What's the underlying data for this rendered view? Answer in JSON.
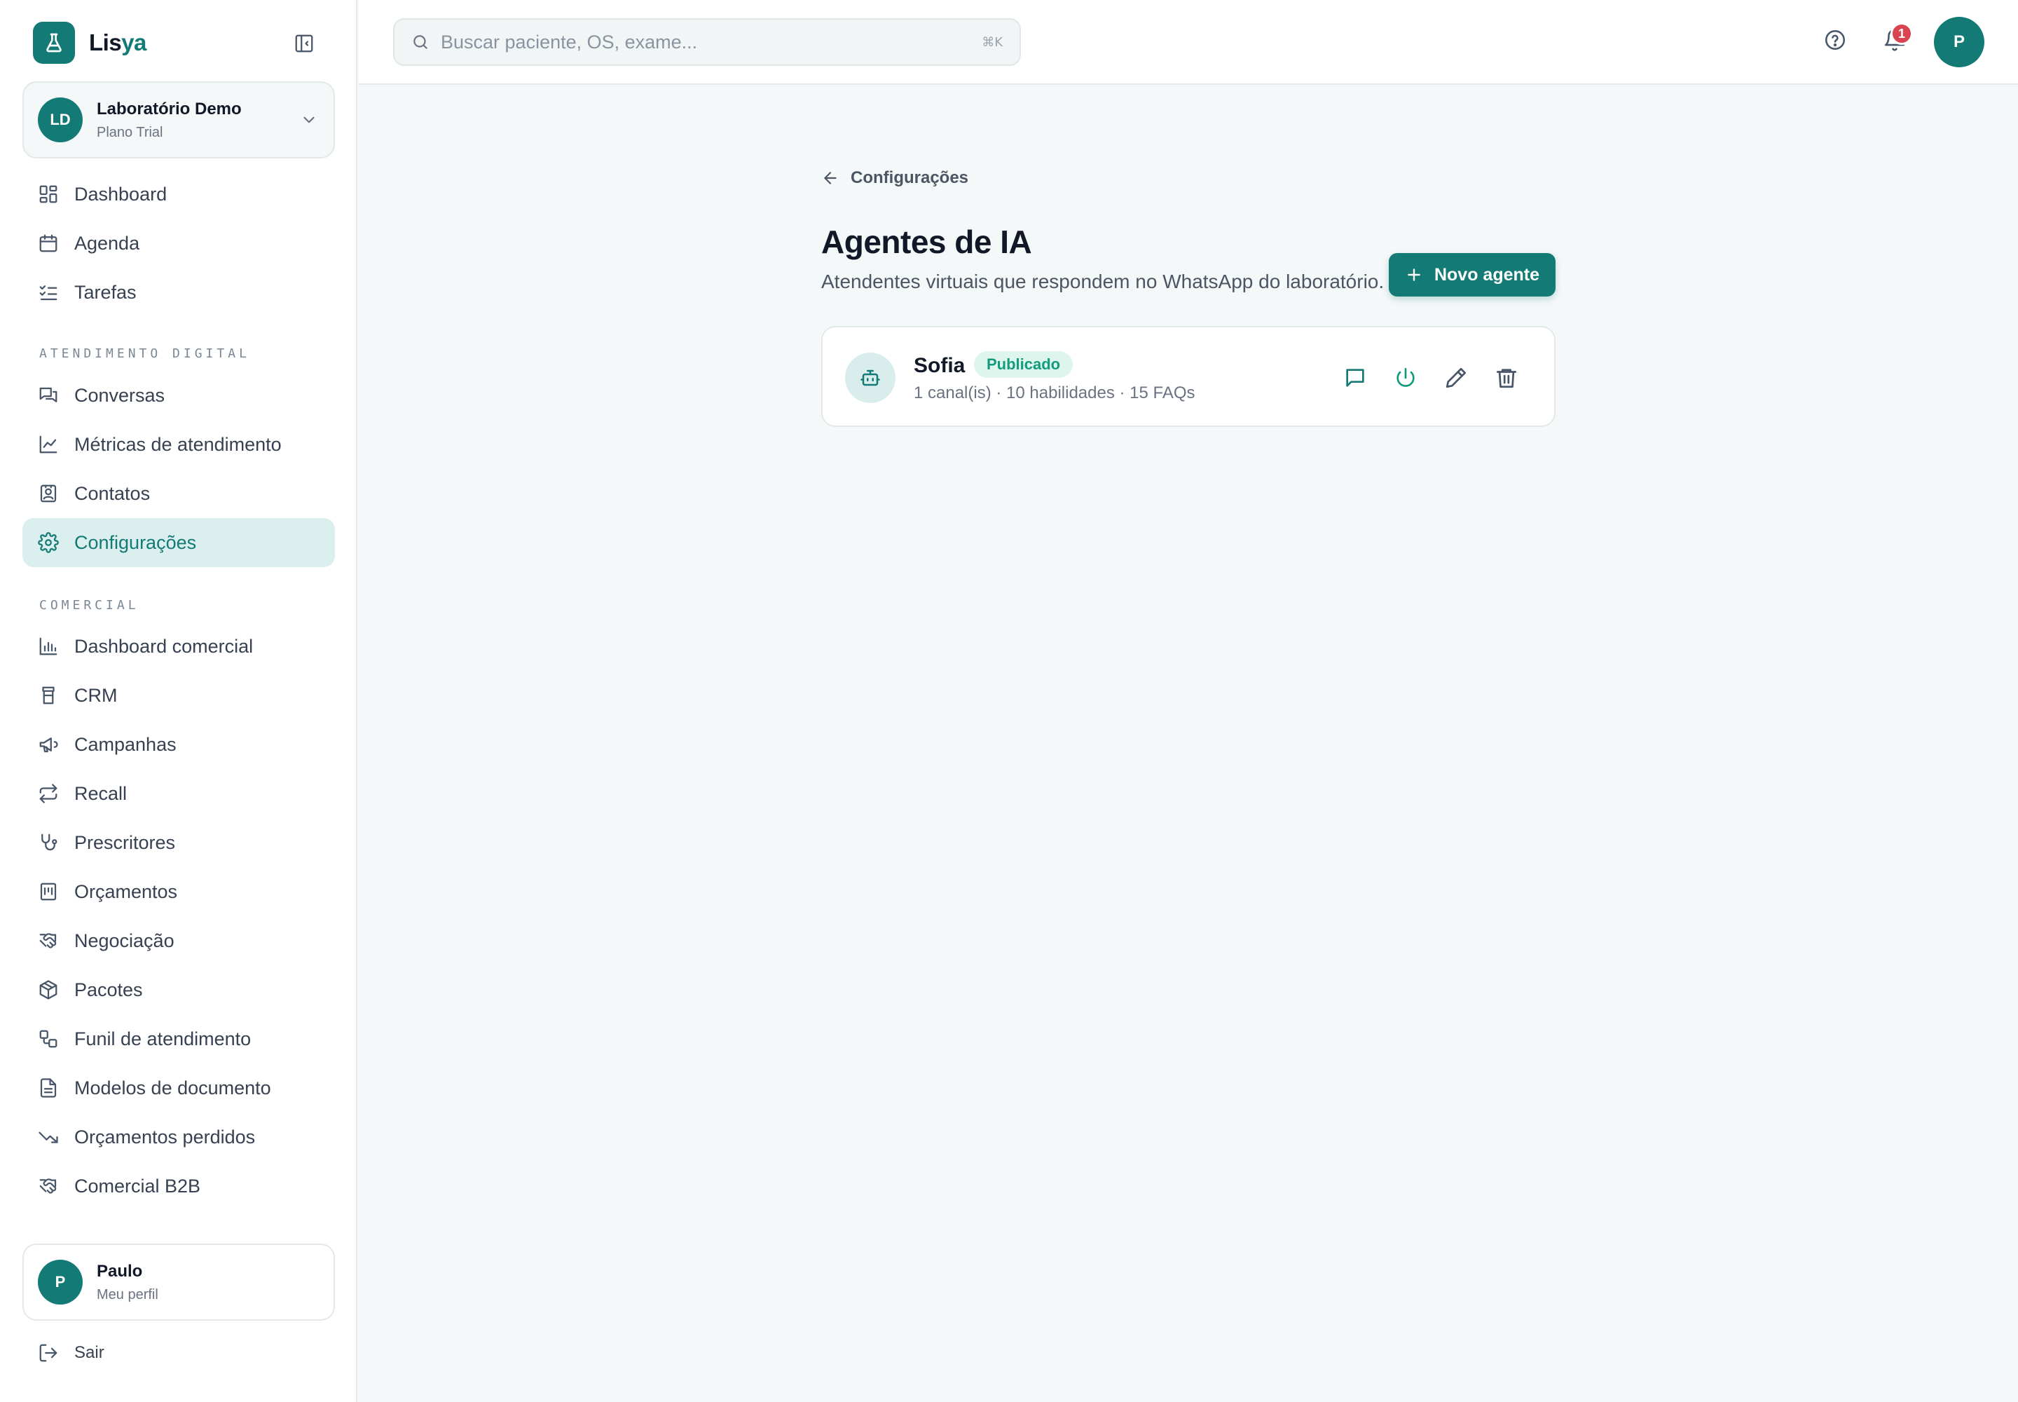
{
  "brand": {
    "name_prefix": "Lis",
    "name_accent": "ya"
  },
  "org": {
    "initials": "LD",
    "name": "Laboratório Demo",
    "plan": "Plano Trial"
  },
  "nav": {
    "main": [
      {
        "label": "Dashboard",
        "icon": "dashboard-icon"
      },
      {
        "label": "Agenda",
        "icon": "calendar-icon"
      },
      {
        "label": "Tarefas",
        "icon": "checklist-icon"
      }
    ],
    "digital_title": "ATENDIMENTO DIGITAL",
    "digital": [
      {
        "label": "Conversas",
        "icon": "chats-icon"
      },
      {
        "label": "Métricas de atendimento",
        "icon": "line-chart-icon"
      },
      {
        "label": "Contatos",
        "icon": "contacts-icon"
      },
      {
        "label": "Configurações",
        "icon": "gear-icon",
        "active": true
      }
    ],
    "commercial_title": "COMERCIAL",
    "commercial": [
      {
        "label": "Dashboard comercial",
        "icon": "bar-chart-icon"
      },
      {
        "label": "CRM",
        "icon": "crm-icon"
      },
      {
        "label": "Campanhas",
        "icon": "megaphone-icon"
      },
      {
        "label": "Recall",
        "icon": "repeat-icon"
      },
      {
        "label": "Prescritores",
        "icon": "stethoscope-icon"
      },
      {
        "label": "Orçamentos",
        "icon": "receipt-icon"
      },
      {
        "label": "Negociação",
        "icon": "handshake-icon"
      },
      {
        "label": "Pacotes",
        "icon": "package-icon"
      },
      {
        "label": "Funil de atendimento",
        "icon": "workflow-icon"
      },
      {
        "label": "Modelos de documento",
        "icon": "document-icon"
      },
      {
        "label": "Orçamentos perdidos",
        "icon": "trending-down-icon"
      },
      {
        "label": "Comercial B2B",
        "icon": "handshake-icon"
      }
    ]
  },
  "profile": {
    "initial": "P",
    "name": "Paulo",
    "subtitle": "Meu perfil"
  },
  "logout_label": "Sair",
  "topbar": {
    "search_placeholder": "Buscar paciente, OS, exame...",
    "search_shortcut": "⌘K",
    "notification_count": "1",
    "user_initial": "P"
  },
  "page": {
    "back_label": "Configurações",
    "title": "Agentes de IA",
    "subtitle": "Atendentes virtuais que respondem no WhatsApp do laboratório.",
    "new_button_label": "Novo agente"
  },
  "agents": [
    {
      "name": "Sofia",
      "status": "Publicado",
      "meta": "1 canal(is) · 10 habilidades · 15 FAQs"
    }
  ],
  "colors": {
    "brand": "#137a76",
    "active_nav_bg": "#dbefee",
    "badge_bg": "#def5ee",
    "badge_text": "#129c7c",
    "notification": "#d94452",
    "background": "#f5f8f8"
  }
}
